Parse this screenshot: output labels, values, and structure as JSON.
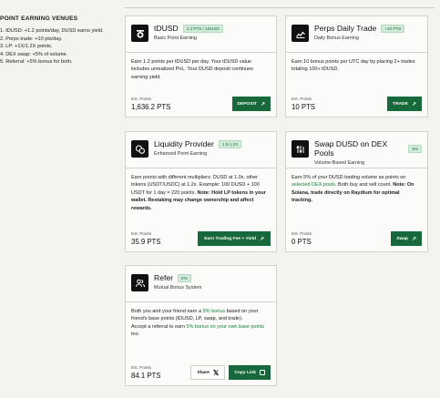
{
  "sidebar": {
    "title": "POINT EARNING VENUES",
    "items": [
      "1. tDUSD: +1.2 points/day, DUSD earns yield.",
      "2. Perps trade: +10 pts/day.",
      "3. LP: +1X/1.2X points.",
      "4. DEX swap: +5% of volume.",
      "5. Referral: +5% bonus for both."
    ]
  },
  "cards": {
    "tdusd": {
      "icon": "tdusd-logo-icon",
      "title": "tDUSD",
      "badge": "1.2 PTS / 1DUSD",
      "subtitle": "Basic Point Earning",
      "body": "Earn 1.2 points per tDUSD per day. Your tDUSD value includes unrealized PnL. Your DUSD deposit continues earning yield.",
      "points_label": "Est. Points",
      "points_value": "1,636.2 PTS",
      "button": "DEPOSIT"
    },
    "perps": {
      "icon": "chart-line-icon",
      "title": "Perps Daily Trade",
      "badge": "+10 PTS",
      "subtitle": "Daily Bonus Earning",
      "body": "Earn 10 bonus points per UTC day by placing 2+ trades totaling 100+ tDUSD.",
      "points_label": "Est. Points",
      "points_value": "10 PTS",
      "button": "TRADE"
    },
    "lp": {
      "icon": "coins-icon",
      "title": "Liquidity Provider",
      "badge": "1.0-1.2X",
      "subtitle": "Enhanced Point Earning",
      "body_plain": "Earn points with different multipliers: DUSD at 1.0x, other tokens (USDT/USDC) at 1.2x. Example: 100 DUSD + 100 USDT for 1 day = 220 points.",
      "body_bold": "Note: Hold LP tokens in your wallet. Restaking may change ownership and affect rewards.",
      "points_label": "Est. Points",
      "points_value": "35.9 PTS",
      "button": "Earn Trading Fee + Yield"
    },
    "swap": {
      "icon": "swap-arrows-icon",
      "title": "Swap DUSD on DEX Pools",
      "badge": "5%",
      "subtitle": "Volume-Based Earning",
      "body_a": "Earn 5% of your DUSD trading volume as points on ",
      "body_link": "selected DEX pools",
      "body_b": ". Both buy and sell count.",
      "body_bold": "Note: On Solana, trade directly on Raydium for optimal tracking.",
      "points_label": "Est. Points",
      "points_value": "0 PTS",
      "button": "Swap"
    },
    "refer": {
      "icon": "users-icon",
      "title": "Refer",
      "badge": "5%",
      "subtitle": "Mutual Bonus System",
      "body_a": "Both you and your friend earn a ",
      "body_hl1": "5% bonus",
      "body_b": " based on your friend's base points (tDUSD, LP, swap, and trade).",
      "body_c": "Accept a referral to earn ",
      "body_hl2": "5% bonus on your own base points",
      "body_d": " too.",
      "points_label": "Est. Points",
      "points_value": "84.1 PTS",
      "share_button": "Share",
      "copy_button": "Copy Link"
    }
  }
}
